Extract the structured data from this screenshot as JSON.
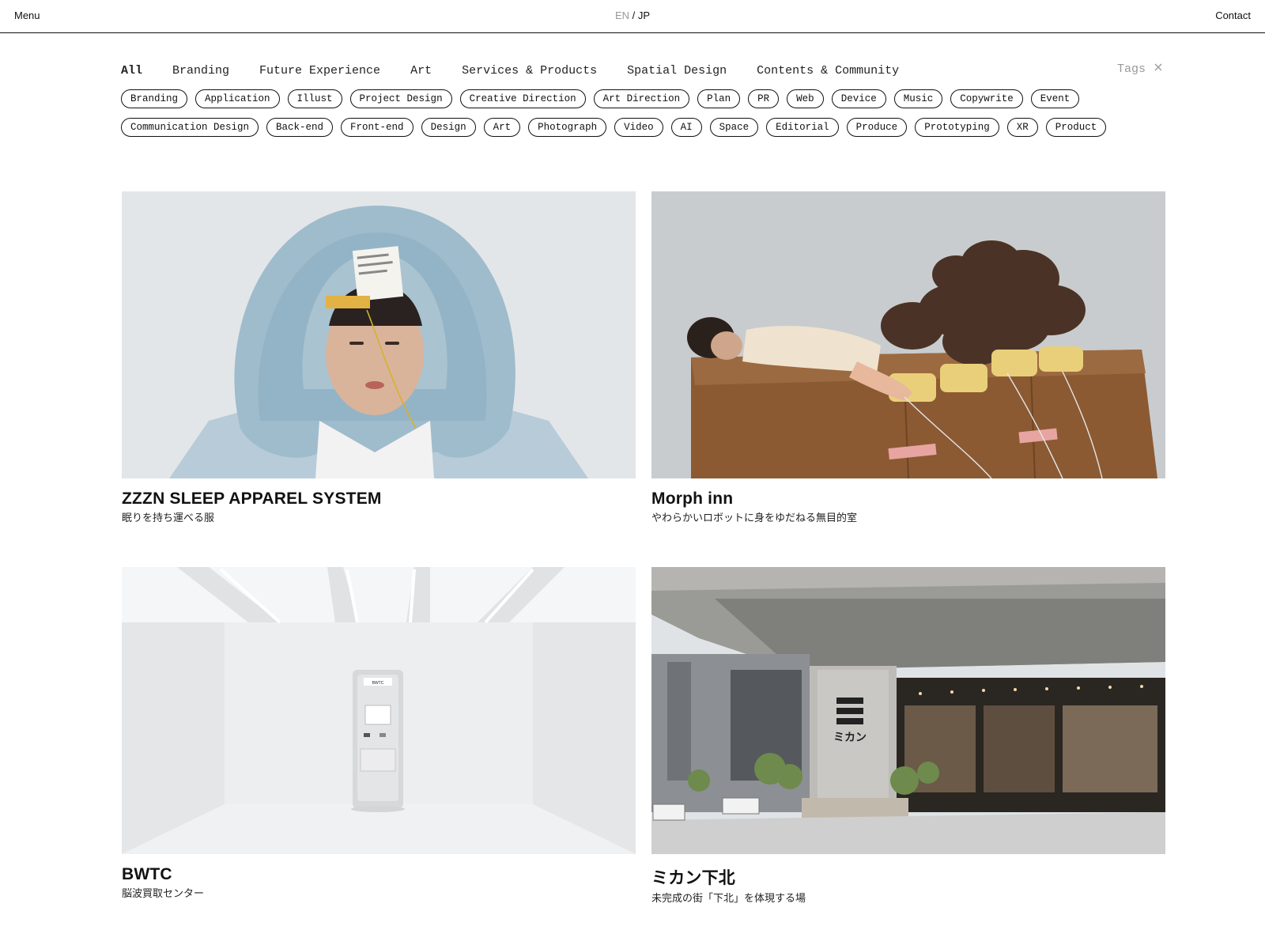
{
  "header": {
    "menu": "Menu",
    "lang_en": "EN",
    "lang_sep": "/",
    "lang_jp": "JP",
    "contact": "Contact"
  },
  "categories": [
    "All",
    "Branding",
    "Future Experience",
    "Art",
    "Services & Products",
    "Spatial Design",
    "Contents & Community"
  ],
  "active_category": "All",
  "tags_toggle": "Tags",
  "tags_close_icon": "close-icon",
  "tags_row1": [
    "Branding",
    "Application",
    "Illust",
    "Project Design",
    "Creative Direction",
    "Art Direction",
    "Plan",
    "PR",
    "Web",
    "Device",
    "Music",
    "Copywrite",
    "Event"
  ],
  "tags_row2": [
    "Communication Design",
    "Back-end",
    "Front-end",
    "Design",
    "Art",
    "Photograph",
    "Video",
    "AI",
    "Space",
    "Editorial",
    "Produce",
    "Prototyping",
    "XR",
    "Product"
  ],
  "projects": [
    {
      "title": "ZZZN SLEEP APPAREL SYSTEM",
      "subtitle": "眠りを持ち運べる服"
    },
    {
      "title": "Morph inn",
      "subtitle": "やわらかいロボットに身をゆだねる無目的室"
    },
    {
      "title": "BWTC",
      "subtitle": "脳波買取センター"
    },
    {
      "title": "ミカン下北",
      "subtitle": "未完成の街「下北」を体現する場"
    }
  ],
  "image_labels": {
    "mikan_sign": "ミカン",
    "bwtc_screen": "BWTC"
  },
  "colors": {
    "text": "#111111",
    "muted": "#999999",
    "background": "#ffffff"
  }
}
